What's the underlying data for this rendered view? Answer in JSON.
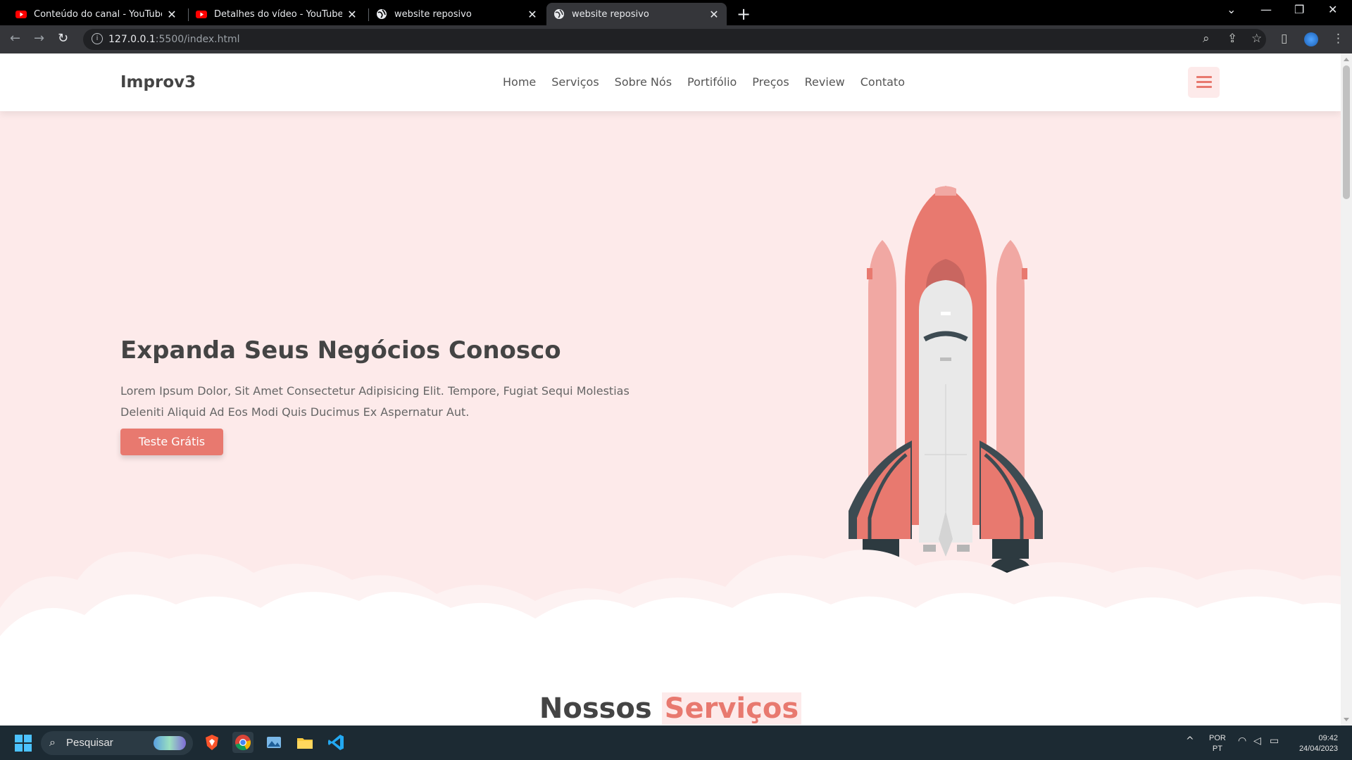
{
  "browser": {
    "tabs": [
      {
        "title": "Conteúdo do canal - YouTube Studio",
        "favicon": "youtube-icon",
        "active": false
      },
      {
        "title": "Detalhes do vídeo - YouTube Studio",
        "favicon": "youtube-icon",
        "active": false
      },
      {
        "title": "website reposivo",
        "favicon": "globe-icon",
        "active": false
      },
      {
        "title": "website reposivo",
        "favicon": "globe-icon",
        "active": true
      }
    ],
    "new_tab": "+",
    "url_host": "127.0.0.1",
    "url_rest": ":5500/index.html"
  },
  "site": {
    "logo": "Improv3",
    "nav": [
      "Home",
      "Serviços",
      "Sobre Nós",
      "Portifólio",
      "Preços",
      "Review",
      "Contato"
    ],
    "hero": {
      "title": "Expanda Seus Negócios Conosco",
      "text": "Lorem Ipsum Dolor, Sit Amet Consectetur Adipisicing Elit. Tempore, Fugiat Sequi Molestias Deleniti Aliquid Ad Eos Modi Quis Ducimus Ex Aspernatur Aut.",
      "cta": "Teste Grátis"
    },
    "section_title_main": "Nossos",
    "section_title_highlight": "Serviços"
  },
  "taskbar": {
    "search_label": "Pesquisar",
    "lang_line1": "POR",
    "lang_line2": "PT",
    "time": "09:42",
    "date": "24/04/2023"
  },
  "colors": {
    "accent": "#e8796f",
    "hero_bg": "#fdeaea",
    "text_dark": "#444444"
  }
}
